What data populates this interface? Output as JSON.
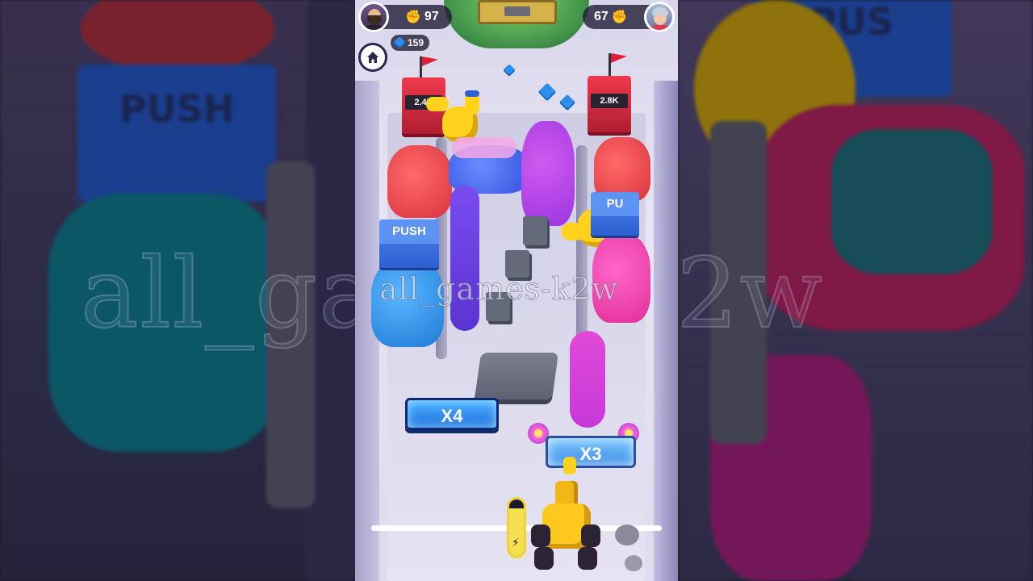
{
  "hud": {
    "left_score": "97",
    "right_score": "67",
    "gems": "159",
    "left_score_icon": "blue-fist-icon",
    "right_score_icon": "red-fist-icon",
    "gem_icon": "blue-gem-icon",
    "home_icon": "home-icon"
  },
  "towers": {
    "left_value": "2.4K",
    "right_value": "2.8K"
  },
  "push_blocks": {
    "left_label": "PUSH",
    "right_label": "PU",
    "background_left_label": "PUSH",
    "background_right_label": "PUS"
  },
  "gates": {
    "left": "X4",
    "right": "X3"
  },
  "shooter": {
    "energy_level": 0.85
  },
  "watermark": "all_games-k2w",
  "colors": {
    "team_blue": "#2f6fe8",
    "team_red": "#e2394a",
    "crowd_purple": "#8f3cf0",
    "crowd_magenta": "#e23cc8",
    "crowd_cyan": "#2fa7e8",
    "yellow_unit": "#ffd21e"
  }
}
